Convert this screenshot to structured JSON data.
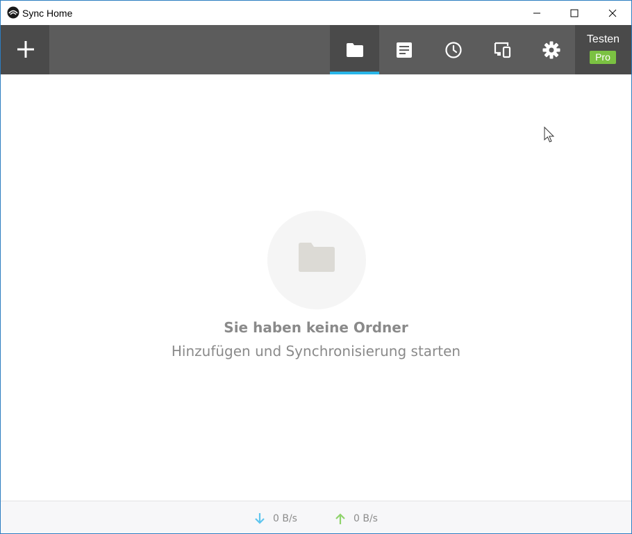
{
  "window": {
    "title": "Sync Home"
  },
  "toolbar": {
    "add_icon": "plus-icon",
    "tabs": [
      {
        "name": "folders",
        "icon": "folder-icon",
        "active": true
      },
      {
        "name": "notes",
        "icon": "document-icon",
        "active": false
      },
      {
        "name": "history",
        "icon": "clock-icon",
        "active": false
      },
      {
        "name": "devices",
        "icon": "devices-icon",
        "active": false
      },
      {
        "name": "settings",
        "icon": "gear-icon",
        "active": false
      }
    ],
    "account": {
      "name": "Testen",
      "badge": "Pro"
    }
  },
  "empty_state": {
    "icon": "folder-icon",
    "title": "Sie haben keine Ordner",
    "subtitle": "Hinzufügen und Synchronisierung starten"
  },
  "status": {
    "download_rate": "0 B/s",
    "upload_rate": "0 B/s"
  },
  "colors": {
    "toolbar": "#5c5c5c",
    "toolbar_dark": "#4a4a4a",
    "active_indicator": "#29b6e8",
    "pro_badge": "#7bc142",
    "download_arrow": "#5ec5ee",
    "upload_arrow": "#8fd36c"
  }
}
